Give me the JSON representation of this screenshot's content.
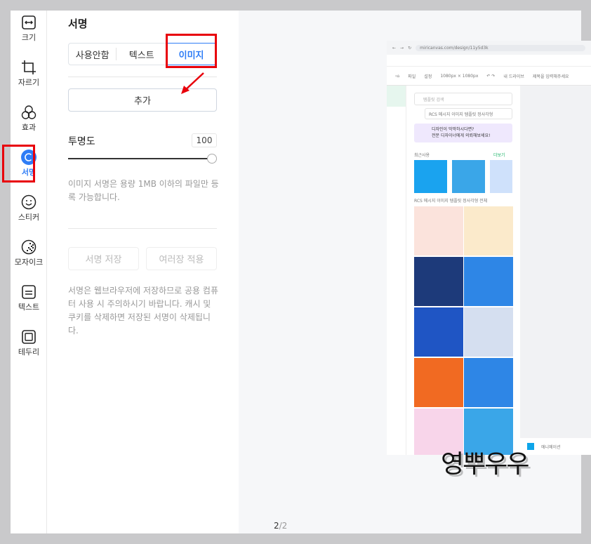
{
  "sidebar": {
    "items": [
      {
        "label": "크기",
        "icon": "resize-icon"
      },
      {
        "label": "자르기",
        "icon": "crop-icon"
      },
      {
        "label": "효과",
        "icon": "effects-icon"
      },
      {
        "label": "서명",
        "icon": "signature-icon",
        "active": true
      },
      {
        "label": "스티커",
        "icon": "sticker-icon"
      },
      {
        "label": "모자이크",
        "icon": "mosaic-icon"
      },
      {
        "label": "텍스트",
        "icon": "text-icon"
      },
      {
        "label": "테두리",
        "icon": "border-icon"
      }
    ]
  },
  "panel": {
    "title": "서명",
    "segments": [
      "사용안함",
      "텍스트",
      "이미지"
    ],
    "selected_segment": "이미지",
    "add_label": "추가",
    "opacity_label": "투명도",
    "opacity_value": "100",
    "opacity_level": 100,
    "image_note": "이미지 서명은 용량 1MB 이하의 파일만 등록 가능합니다.",
    "save_label": "서명 저장",
    "apply_many_label": "여러장 적용",
    "storage_note": "서명은 웹브라우저에 저장하므로 공용 컴퓨터 사용 시 주의하시기 바랍니다. 캐시 및 쿠키를 삭제하면 저장된 서명이 삭제됩니다."
  },
  "preview": {
    "page": "2",
    "total": "/2",
    "signature_text": "영뿌우우",
    "screenshot": {
      "url": "miricanvas.com/design/11y5d3k",
      "menu": [
        "파일",
        "설정",
        "1080px × 1080px"
      ],
      "drive": "내 드라이브",
      "doc_title": "제목을 입력해주세요",
      "search_placeholder": "템플릿 검색",
      "category": "RCS 메시지 이미지 템플릿 정사각형",
      "banner_title": "디자인이 막막하시다면?",
      "banner_sub": "전문 디자이너에게 의뢰해보세요!",
      "recent": "최근사용",
      "more": "더보기",
      "all": "RCS 메시지 이미지 템플릿 정사각형 전체",
      "animation": "애니메이션"
    }
  },
  "colors": {
    "accent": "#2f7df6",
    "highlight": "#e8000b"
  }
}
